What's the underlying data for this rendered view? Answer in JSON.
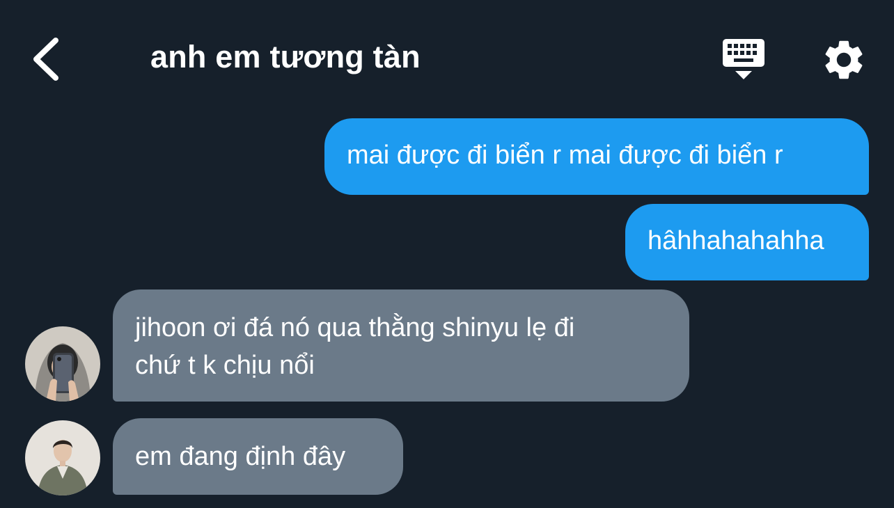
{
  "header": {
    "title": "anh em tương tàn",
    "back_icon": "chevron-left-icon",
    "keyboard_icon": "keyboard-hide-icon",
    "settings_icon": "gear-icon"
  },
  "colors": {
    "background": "#16202b",
    "outgoing_bubble": "#1d9bf0",
    "incoming_bubble": "#6b7a89",
    "text": "#ffffff"
  },
  "messages": [
    {
      "direction": "outgoing",
      "lines": [
        "mai được đi biển r mai được đi biển r"
      ]
    },
    {
      "direction": "outgoing",
      "lines": [
        "hâhhahahahha"
      ]
    },
    {
      "direction": "incoming",
      "avatar": "avatar-hoodie-mirror-selfie",
      "lines": [
        "jihoon ơi đá nó qua thằng shinyu lẹ đi",
        "chứ t k chịu nổi"
      ]
    },
    {
      "direction": "incoming",
      "avatar": "avatar-jacket-portrait",
      "lines": [
        "em đang định đây"
      ]
    }
  ]
}
